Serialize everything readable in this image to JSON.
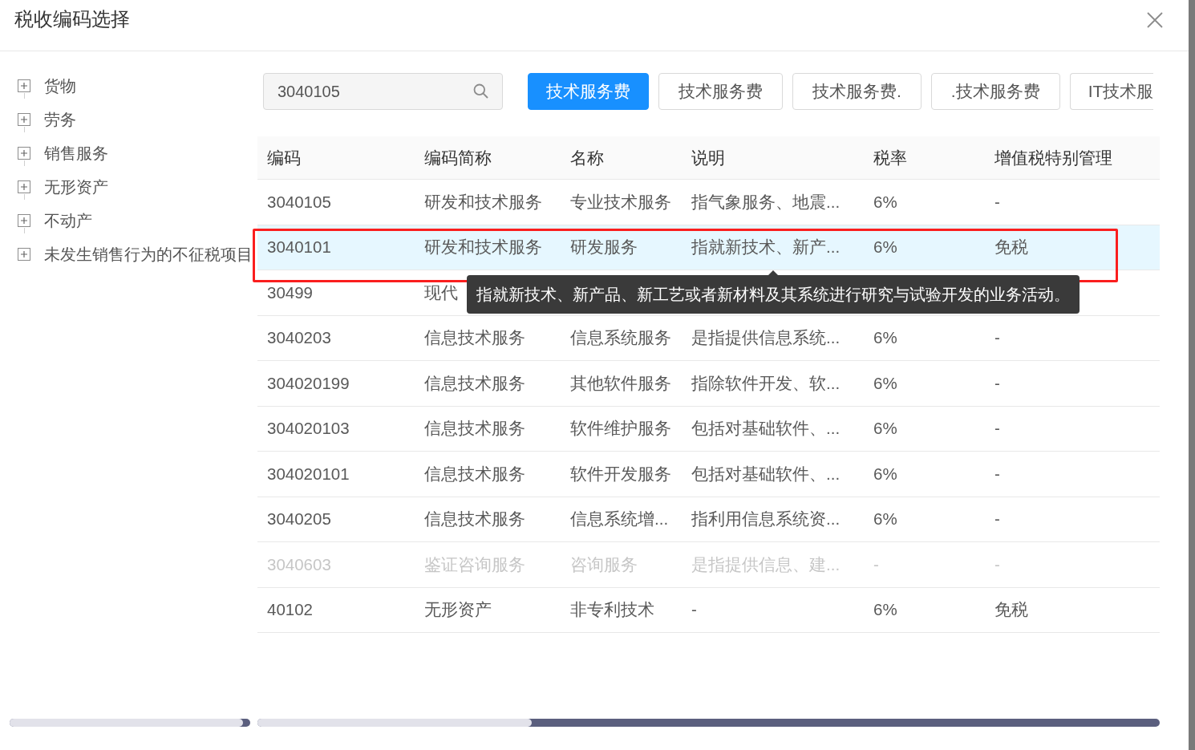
{
  "dialog": {
    "title": "税收编码选择"
  },
  "tree": {
    "items": [
      {
        "label": "货物",
        "expanded": false
      },
      {
        "label": "劳务",
        "expanded": false
      },
      {
        "label": "销售服务",
        "expanded": false
      },
      {
        "label": "无形资产",
        "expanded": false
      },
      {
        "label": "不动产",
        "expanded": false
      },
      {
        "label": "未发生销售行为的不征税项目",
        "expanded": false
      }
    ]
  },
  "search": {
    "value": "3040105"
  },
  "tags": [
    {
      "label": "技术服务费",
      "selected": true
    },
    {
      "label": "技术服务费",
      "selected": false
    },
    {
      "label": "技术服务费.",
      "selected": false
    },
    {
      "label": ".技术服务费",
      "selected": false
    },
    {
      "label": "IT技术服",
      "selected": false
    }
  ],
  "table": {
    "columns": [
      "编码",
      "编码简称",
      "名称",
      "说明",
      "税率",
      "增值税特别管理"
    ],
    "rows": [
      {
        "cells": [
          "3040105",
          "研发和技术服务",
          "专业技术服务",
          "指气象服务、地震...",
          "6%",
          "-"
        ],
        "selected": false,
        "disabled": false,
        "outlined": false
      },
      {
        "cells": [
          "3040101",
          "研发和技术服务",
          "研发服务",
          "指就新技术、新产...",
          "6%",
          "免税"
        ],
        "selected": true,
        "disabled": false,
        "outlined": true,
        "tooltip": "指就新技术、新产品、新工艺或者新材料及其系统进行研究与试验开发的业务活动。"
      },
      {
        "cells": [
          "30499",
          "现代"
        ],
        "selected": false,
        "disabled": false,
        "outlined": false
      },
      {
        "cells": [
          "3040203",
          "信息技术服务",
          "信息系统服务",
          "是指提供信息系统...",
          "6%",
          "-"
        ],
        "selected": false,
        "disabled": false,
        "outlined": false
      },
      {
        "cells": [
          "304020199",
          "信息技术服务",
          "其他软件服务",
          "指除软件开发、软...",
          "6%",
          "-"
        ],
        "selected": false,
        "disabled": false,
        "outlined": false
      },
      {
        "cells": [
          "304020103",
          "信息技术服务",
          "软件维护服务",
          "包括对基础软件、...",
          "6%",
          "-"
        ],
        "selected": false,
        "disabled": false,
        "outlined": false
      },
      {
        "cells": [
          "304020101",
          "信息技术服务",
          "软件开发服务",
          "包括对基础软件、...",
          "6%",
          "-"
        ],
        "selected": false,
        "disabled": false,
        "outlined": false
      },
      {
        "cells": [
          "3040205",
          "信息技术服务",
          "信息系统增...",
          "指利用信息系统资...",
          "6%",
          "-"
        ],
        "selected": false,
        "disabled": false,
        "outlined": false
      },
      {
        "cells": [
          "3040603",
          "鉴证咨询服务",
          "咨询服务",
          "是指提供信息、建...",
          "-",
          "-"
        ],
        "selected": false,
        "disabled": true,
        "outlined": false
      },
      {
        "cells": [
          "40102",
          "无形资产",
          "非专利技术",
          "-",
          "6%",
          "免税"
        ],
        "selected": false,
        "disabled": false,
        "outlined": false
      }
    ]
  }
}
